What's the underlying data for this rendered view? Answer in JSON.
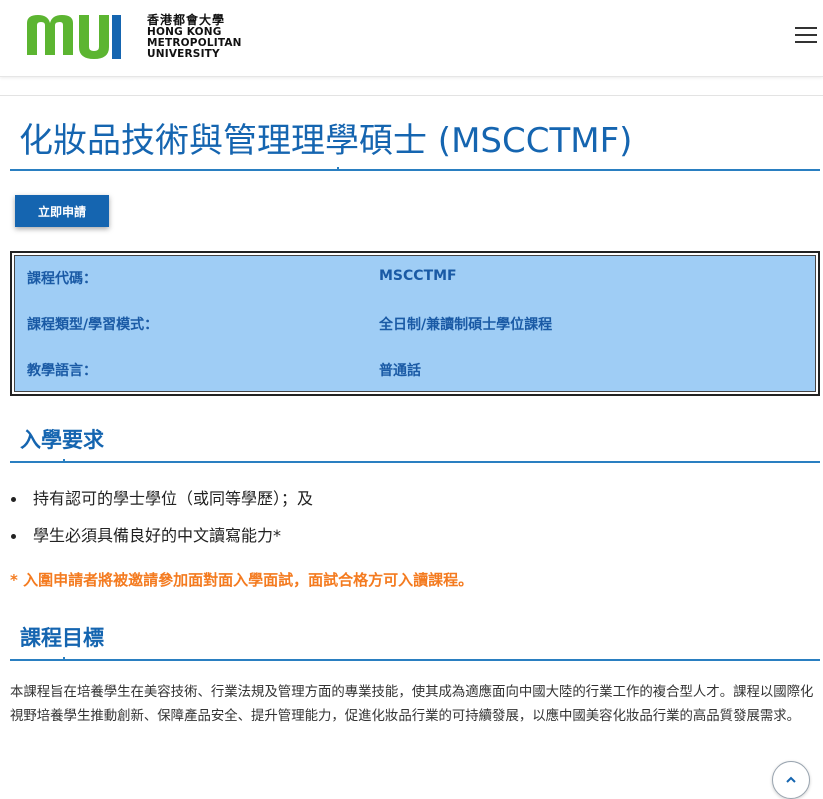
{
  "header": {
    "logo_cn": "香港都會大學",
    "logo_en_lines": [
      "HONG KONG",
      "METROPOLITAN",
      "UNIVERSITY"
    ],
    "menu_icon": "hamburger-menu-icon",
    "brand_colors": {
      "logo_green": "#5cb531",
      "logo_blue": "#1565b0"
    }
  },
  "page": {
    "title": "化妝品技術與管理理學碩士 (MSCCTMF)",
    "apply_button": "立即申請",
    "accent_color": "#1565b0"
  },
  "info": {
    "rows": [
      {
        "label": "課程代碼：",
        "value": "MSCCTMF"
      },
      {
        "label": "課程類型/學習模式：",
        "value": "全日制/兼讀制碩士學位課程"
      },
      {
        "label": "教學語言：",
        "value": "普通話"
      }
    ],
    "background_color": "#9fcdf5"
  },
  "requirements": {
    "title": "入學要求",
    "items": [
      "持有認可的學士學位（或同等學歷）；及",
      "學生必須具備良好的中文讀寫能力*"
    ],
    "note": "* 入圍申請者將被邀請參加面對面入學面試，面試合格方可入讀課程。",
    "note_color": "#f47b20"
  },
  "objectives": {
    "title": "課程目標",
    "text": "本課程旨在培養學生在美容技術、行業法規及管理方面的專業技能，使其成為適應面向中國大陸的行業工作的複合型人才。課程以國際化視野培養學生推動創新、保障產品安全、提升管理能力，促進化妝品行業的可持續發展，以應中國美容化妝品行業的高品質發展需求。"
  },
  "back_to_top_icon": "chevron-up-icon"
}
